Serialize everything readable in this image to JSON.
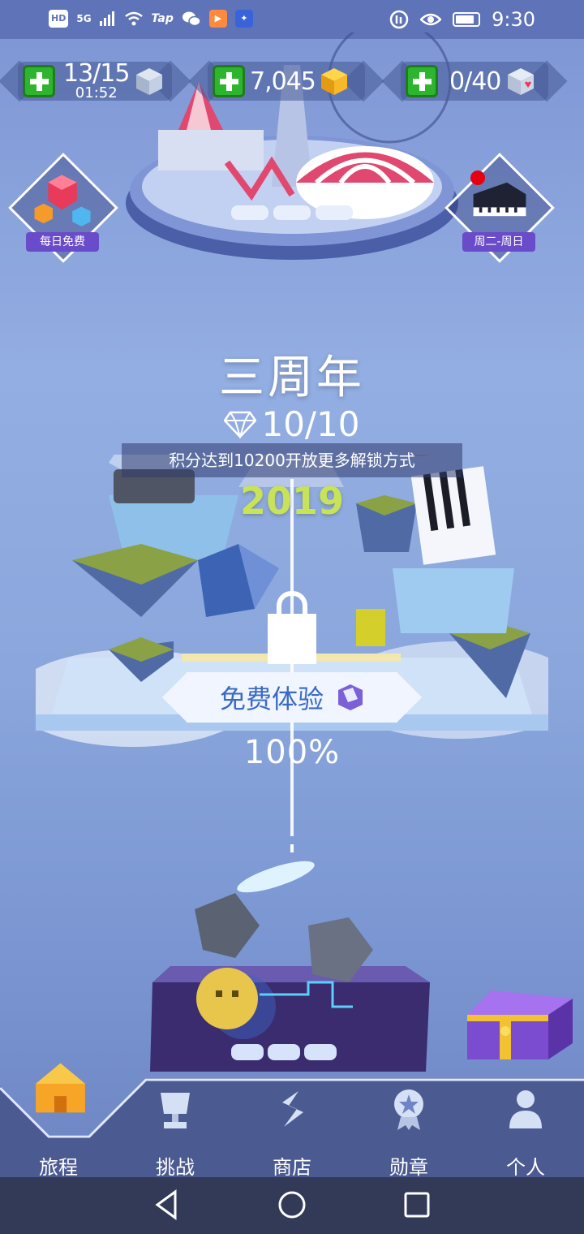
{
  "status_bar": {
    "left_badges": [
      "HD",
      "5G",
      "Tap"
    ],
    "time": "9:30"
  },
  "resources": [
    {
      "id": "energy",
      "value": "13/15",
      "sub": "01:52",
      "icon": "crystal-cube-icon"
    },
    {
      "id": "gold",
      "value": "7,045",
      "icon": "gold-cube-icon"
    },
    {
      "id": "hearts",
      "value": "0/40",
      "icon": "heart-cube-icon"
    }
  ],
  "side_badges": {
    "left_label": "每日免费",
    "right_label": "周二-周日"
  },
  "level": {
    "title": "三周年",
    "gems": "10/10",
    "hint": "积分达到10200开放更多解锁方式",
    "year": "2019",
    "trial_button": "免费体验",
    "progress": "100%"
  },
  "nav": {
    "items": [
      {
        "label": "旅程",
        "icon": "house-icon"
      },
      {
        "label": "挑战",
        "icon": "trophy-icon"
      },
      {
        "label": "商店",
        "icon": "shop-icon"
      },
      {
        "label": "勋章",
        "icon": "medal-icon"
      },
      {
        "label": "个人",
        "icon": "person-icon"
      }
    ]
  },
  "colors": {
    "accent_green": "#2db52d",
    "year_green": "#c8e25a",
    "trial_text": "#3a6ac7",
    "nav_bg": "#4c5a92"
  }
}
